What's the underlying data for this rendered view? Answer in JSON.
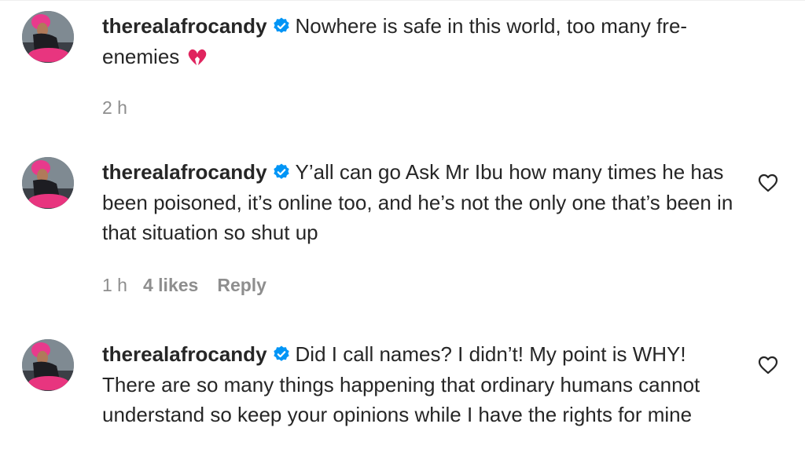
{
  "comments": [
    {
      "username": "therealafrocandy",
      "text": "Nowhere is safe in this world, too many fre-enemies",
      "emoji": "broken-heart",
      "time": "2 h",
      "likes": "",
      "reply": ""
    },
    {
      "username": "therealafrocandy",
      "text": "Y’all can go Ask Mr Ibu how many times he has been poisoned, it’s online too, and he’s not the only one that’s been in that situation so shut up",
      "time": "1 h",
      "likes": "4 likes",
      "reply": "Reply"
    },
    {
      "username": "therealafrocandy",
      "text": "Did I call names? I didn’t! My point is WHY! There are so many things happening that ordinary humans cannot understand so keep your opinions while I have the rights for mine"
    }
  ],
  "icons": {
    "verified": "verified-badge-icon",
    "like": "heart-outline-icon",
    "emoji": "broken-heart-icon"
  },
  "colors": {
    "verified_blue": "#0095f6",
    "meta_gray": "#8e8e8e",
    "text": "#262626",
    "broken_heart": "#e0245e"
  }
}
